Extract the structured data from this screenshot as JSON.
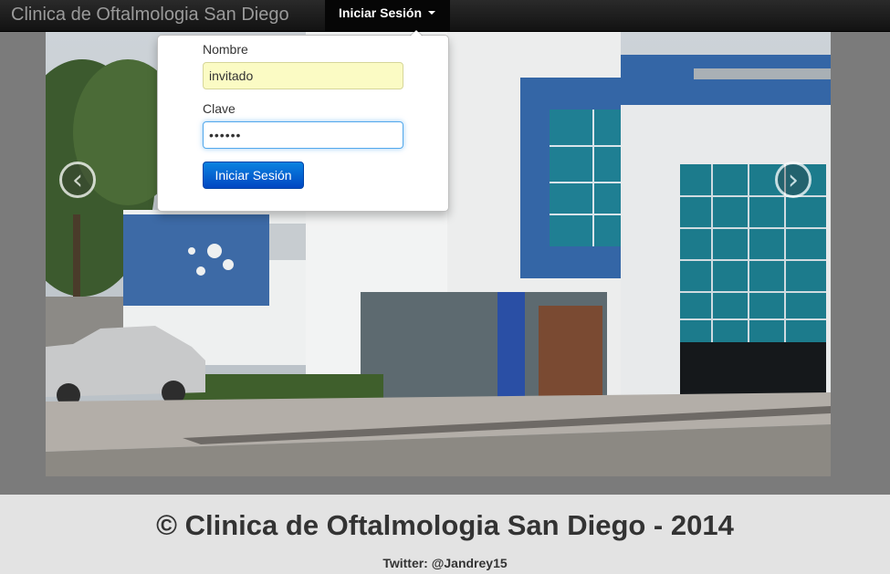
{
  "navbar": {
    "brand": "Clinica de Oftalmologia San Diego",
    "login_menu_label": "Iniciar Sesión"
  },
  "login_form": {
    "username_label": "Nombre",
    "username_value": "invitado",
    "password_label": "Clave",
    "password_value": "••••••",
    "submit_label": "Iniciar Sesión"
  },
  "carousel": {
    "image_alt": "Clinica building photo",
    "prev_icon": "‹",
    "next_icon": "›"
  },
  "footer": {
    "copyright": "© Clinica de Oftalmologia San Diego - 2014",
    "twitter": "Twitter: @Jandrey15"
  },
  "colors": {
    "navbar": "#1b1b1b",
    "page_background": "#7b7b7b",
    "footer_background": "#e3e3e3",
    "primary_button": "#0068d6",
    "autofill_background": "#fbfbc4"
  }
}
